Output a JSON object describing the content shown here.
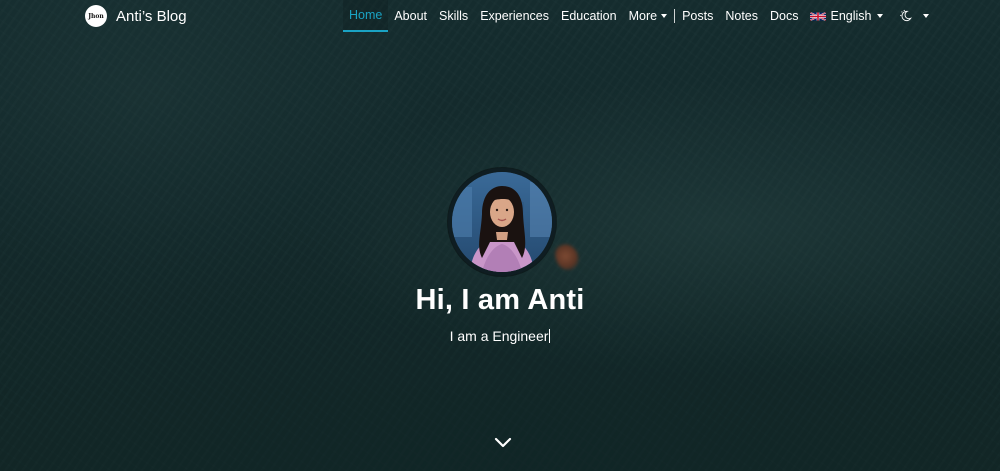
{
  "brand": {
    "logo_text": "Jhon",
    "name": "Anti’s Blog"
  },
  "nav": {
    "items": [
      {
        "label": "Home",
        "active": true
      },
      {
        "label": "About"
      },
      {
        "label": "Skills"
      },
      {
        "label": "Experiences"
      },
      {
        "label": "Education"
      },
      {
        "label": "More",
        "dropdown": true
      },
      {
        "label": "Posts"
      },
      {
        "label": "Notes"
      },
      {
        "label": "Docs"
      }
    ],
    "language": {
      "label": "English",
      "icon": "uk-flag-icon"
    },
    "theme_icon": "theme-toggle-icon"
  },
  "hero": {
    "title": "Hi, I am Anti",
    "subtitle": "I am a Engineer"
  },
  "colors": {
    "accent": "#1aa3c4",
    "background": "#163336",
    "text": "#ffffff"
  }
}
